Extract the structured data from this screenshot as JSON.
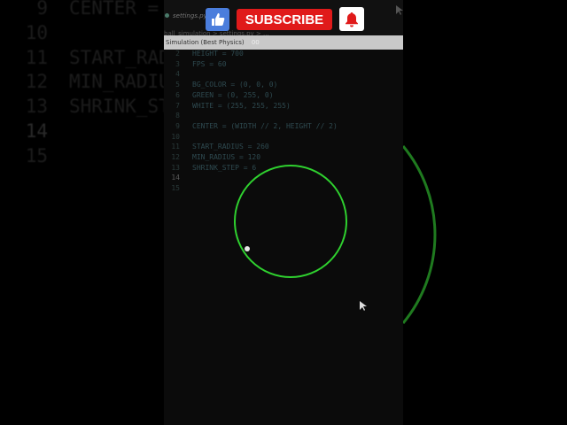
{
  "background_editor": {
    "lines": [
      {
        "num": "9",
        "code": "CENTER = "
      },
      {
        "num": "10",
        "code": ""
      },
      {
        "num": "11",
        "code": "START_RADIUS"
      },
      {
        "num": "12",
        "code": "MIN_RADIUS"
      },
      {
        "num": "13",
        "code": "SHRINK_STE"
      },
      {
        "num": "14",
        "code": ""
      },
      {
        "num": "15",
        "code": ""
      }
    ]
  },
  "editor": {
    "tab_label": "settings.py",
    "breadcrumb": "ball_simulation > settings.py > ...",
    "lines": [
      {
        "num": "2",
        "code": "HEIGHT = 700"
      },
      {
        "num": "3",
        "code": "FPS = 60"
      },
      {
        "num": "4",
        "code": ""
      },
      {
        "num": "5",
        "code": "BG_COLOR = (0, 0, 0)"
      },
      {
        "num": "6",
        "code": "GREEN = (0, 255, 0)"
      },
      {
        "num": "7",
        "code": "WHITE = (255, 255, 255)"
      },
      {
        "num": "8",
        "code": ""
      },
      {
        "num": "9",
        "code": "CENTER = (WIDTH // 2, HEIGHT // 2)"
      },
      {
        "num": "10",
        "code": ""
      },
      {
        "num": "11",
        "code": "START_RADIUS = 260"
      },
      {
        "num": "12",
        "code": "MIN_RADIUS = 120"
      },
      {
        "num": "13",
        "code": "SHRINK_STEP = 6"
      },
      {
        "num": "14",
        "code": ""
      },
      {
        "num": "15",
        "code": ""
      }
    ]
  },
  "simulation_window": {
    "title": "Simulation (Best Physics)",
    "title_suffix": "00"
  },
  "overlay": {
    "subscribe_label": "SUBSCRIBE"
  },
  "colors": {
    "ring": "#2fd12f",
    "ball": "#e8e8e8",
    "subscribe": "#e01a1a",
    "like": "#4a7ddc"
  }
}
